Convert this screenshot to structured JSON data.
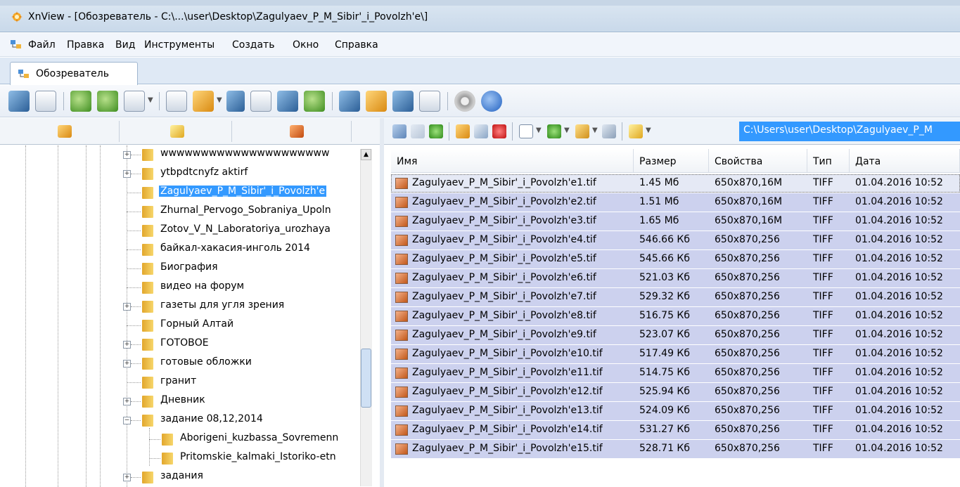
{
  "window": {
    "title": "XnView - [Обозреватель - C:\\...\\user\\Desktop\\Zagulyaev_P_M_Sibir'_i_Povolzh'e\\]"
  },
  "menu": {
    "items": [
      "Файл",
      "Правка",
      "Вид",
      "Инструменты",
      "Создать",
      "Окно",
      "Справка"
    ]
  },
  "tab": {
    "label": "Обозреватель"
  },
  "path": {
    "value": "C:\\Users\\user\\Desktop\\Zagulyaev_P_M"
  },
  "tree": {
    "items": [
      {
        "label": "wwwwwwwwwwwwwwwwwwwww"
      },
      {
        "label": "ytbpdtcnyfz aktirf"
      },
      {
        "label": "Zagulyaev_P_M_Sibir'_i_Povolzh'e"
      },
      {
        "label": "Zhurnal_Pervogo_Sobraniya_Upoln"
      },
      {
        "label": "Zotov_V_N_Laboratoriya_urozhaya"
      },
      {
        "label": "байкал-хакасия-инголь 2014"
      },
      {
        "label": "Биография"
      },
      {
        "label": "видео на форум"
      },
      {
        "label": "газеты для угля зрения"
      },
      {
        "label": "Горный Алтай"
      },
      {
        "label": "ГОТОВОЕ"
      },
      {
        "label": "готовые обложки"
      },
      {
        "label": "гранит"
      },
      {
        "label": "Дневник"
      },
      {
        "label": "задание 08,12,2014"
      },
      {
        "label": "Aborigeni_kuzbassa_Sovremenn"
      },
      {
        "label": "Pritomskie_kalmaki_Istoriko-etn"
      },
      {
        "label": "задания"
      }
    ]
  },
  "columns": {
    "name": "Имя",
    "size": "Размер",
    "props": "Свойства",
    "type": "Тип",
    "date": "Дата"
  },
  "files": [
    {
      "name": "Zagulyaev_P_M_Sibir'_i_Povolzh'e1.tif",
      "size": "1.45 Мб",
      "props": "650x870,16M",
      "type": "TIFF",
      "date": "01.04.2016 10:52"
    },
    {
      "name": "Zagulyaev_P_M_Sibir'_i_Povolzh'e2.tif",
      "size": "1.51 Мб",
      "props": "650x870,16M",
      "type": "TIFF",
      "date": "01.04.2016 10:52"
    },
    {
      "name": "Zagulyaev_P_M_Sibir'_i_Povolzh'e3.tif",
      "size": "1.65 Мб",
      "props": "650x870,16M",
      "type": "TIFF",
      "date": "01.04.2016 10:52"
    },
    {
      "name": "Zagulyaev_P_M_Sibir'_i_Povolzh'e4.tif",
      "size": "546.66 Кб",
      "props": "650x870,256",
      "type": "TIFF",
      "date": "01.04.2016 10:52"
    },
    {
      "name": "Zagulyaev_P_M_Sibir'_i_Povolzh'e5.tif",
      "size": "545.66 Кб",
      "props": "650x870,256",
      "type": "TIFF",
      "date": "01.04.2016 10:52"
    },
    {
      "name": "Zagulyaev_P_M_Sibir'_i_Povolzh'e6.tif",
      "size": "521.03 Кб",
      "props": "650x870,256",
      "type": "TIFF",
      "date": "01.04.2016 10:52"
    },
    {
      "name": "Zagulyaev_P_M_Sibir'_i_Povolzh'e7.tif",
      "size": "529.32 Кб",
      "props": "650x870,256",
      "type": "TIFF",
      "date": "01.04.2016 10:52"
    },
    {
      "name": "Zagulyaev_P_M_Sibir'_i_Povolzh'e8.tif",
      "size": "516.75 Кб",
      "props": "650x870,256",
      "type": "TIFF",
      "date": "01.04.2016 10:52"
    },
    {
      "name": "Zagulyaev_P_M_Sibir'_i_Povolzh'e9.tif",
      "size": "523.07 Кб",
      "props": "650x870,256",
      "type": "TIFF",
      "date": "01.04.2016 10:52"
    },
    {
      "name": "Zagulyaev_P_M_Sibir'_i_Povolzh'e10.tif",
      "size": "517.49 Кб",
      "props": "650x870,256",
      "type": "TIFF",
      "date": "01.04.2016 10:52"
    },
    {
      "name": "Zagulyaev_P_M_Sibir'_i_Povolzh'e11.tif",
      "size": "514.75 Кб",
      "props": "650x870,256",
      "type": "TIFF",
      "date": "01.04.2016 10:52"
    },
    {
      "name": "Zagulyaev_P_M_Sibir'_i_Povolzh'e12.tif",
      "size": "525.94 Кб",
      "props": "650x870,256",
      "type": "TIFF",
      "date": "01.04.2016 10:52"
    },
    {
      "name": "Zagulyaev_P_M_Sibir'_i_Povolzh'e13.tif",
      "size": "524.09 Кб",
      "props": "650x870,256",
      "type": "TIFF",
      "date": "01.04.2016 10:52"
    },
    {
      "name": "Zagulyaev_P_M_Sibir'_i_Povolzh'e14.tif",
      "size": "531.27 Кб",
      "props": "650x870,256",
      "type": "TIFF",
      "date": "01.04.2016 10:52"
    },
    {
      "name": "Zagulyaev_P_M_Sibir'_i_Povolzh'e15.tif",
      "size": "528.71 Кб",
      "props": "650x870,256",
      "type": "TIFF",
      "date": "01.04.2016 10:52"
    }
  ],
  "icons": {
    "toolbar": [
      "fullscreen-icon",
      "fit-icon",
      "rotate-left-icon",
      "rotate-right-icon",
      "scan-icon",
      "open-icon",
      "export-icon",
      "find-icon",
      "print-icon",
      "filmstrip-icon",
      "slideshow-icon",
      "camera-icon",
      "wallpaper-icon",
      "web-icon",
      "info-panel-icon",
      "settings-icon",
      "about-icon"
    ],
    "nav": [
      "back-icon",
      "forward-icon",
      "up-icon",
      "new-folder-icon",
      "rename-icon",
      "delete-icon",
      "view-mode-icon",
      "sort-icon",
      "filter-icon",
      "refresh-icon",
      "favorites-icon"
    ]
  },
  "colors": {
    "selection": "#3399ff",
    "row_selected": "#ccd1ee"
  }
}
